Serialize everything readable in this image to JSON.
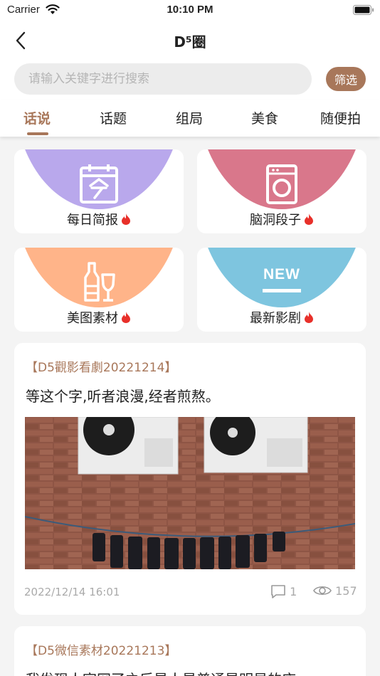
{
  "status_bar": {
    "carrier": "Carrier",
    "time": "10:10 PM"
  },
  "nav": {
    "title": "D⁵圈"
  },
  "search": {
    "placeholder": "请输入关键字进行搜索",
    "filter_label": "筛选"
  },
  "tabs": [
    {
      "label": "话说",
      "active": true
    },
    {
      "label": "话题"
    },
    {
      "label": "组局"
    },
    {
      "label": "美食"
    },
    {
      "label": "随便拍"
    }
  ],
  "categories": [
    {
      "label": "每日简报",
      "color": "#b9a8ec",
      "icon": "calendar-icon"
    },
    {
      "label": "脑洞段子",
      "color": "#d9778b",
      "icon": "washing-machine-icon"
    },
    {
      "label": "美图素材",
      "color": "#ffb489",
      "icon": "bottle-glass-icon"
    },
    {
      "label": "最新影剧",
      "color": "#7ec5df",
      "icon": "new-badge-icon",
      "icon_text": "NEW"
    }
  ],
  "posts": [
    {
      "tag": "【D5觀影看劇20221214】",
      "text": "等这个字,听者浪漫,经者煎熬。",
      "date": "2022/12/14 16:01",
      "comments": "1",
      "views": "157"
    },
    {
      "tag": "【D5微信素材20221213】",
      "text": "我发现人官网了之后是人是普通是明显的庆"
    }
  ],
  "colors": {
    "accent": "#a8775a",
    "fire": "#e8302a"
  }
}
